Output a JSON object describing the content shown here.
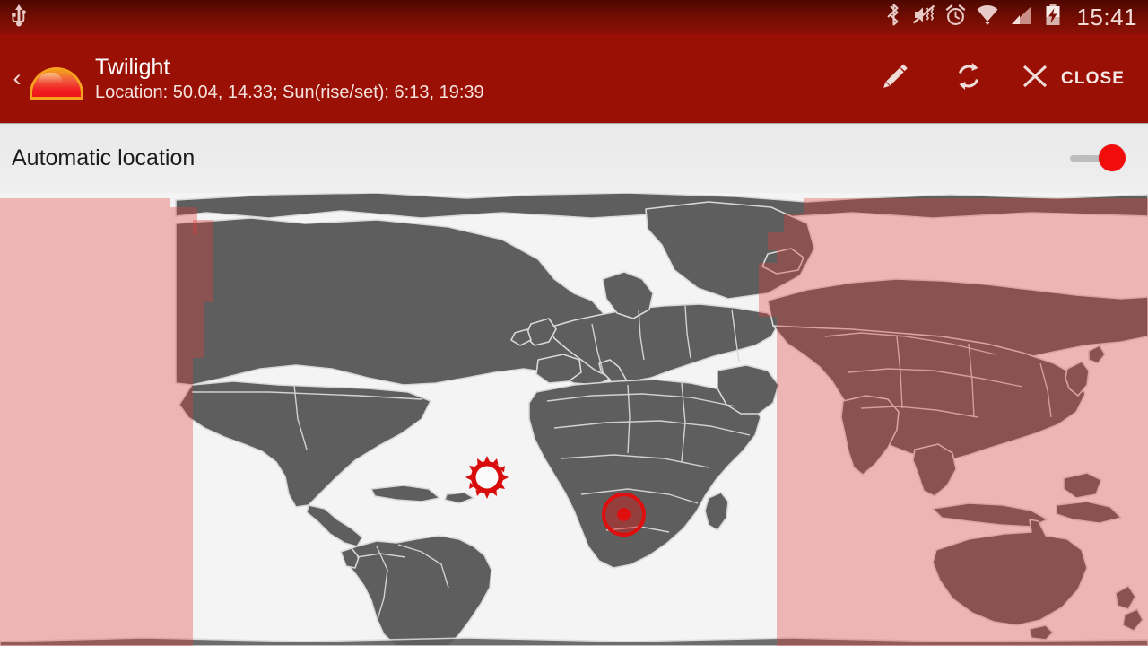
{
  "status_bar": {
    "time": "15:41",
    "icons": [
      {
        "name": "usb-icon",
        "label": "USB connected"
      },
      {
        "name": "bluetooth-icon",
        "label": "Bluetooth on"
      },
      {
        "name": "vibrate-muted-icon",
        "label": "Sound muted / vibrate"
      },
      {
        "name": "alarm-icon",
        "label": "Alarm set"
      },
      {
        "name": "wifi-icon",
        "label": "Wi-Fi connected"
      },
      {
        "name": "signal-bars-icon",
        "label": "Cellular signal"
      },
      {
        "name": "battery-charging-icon",
        "label": "Battery charging"
      }
    ]
  },
  "action_bar": {
    "back_chevron": "‹",
    "app_icon_name": "twilight-sunset-icon",
    "title": "Twilight",
    "subtitle": "Location: 50.04, 14.33; Sun(rise/set): 6:13, 19:39",
    "location_latitude": "50.04",
    "location_longitude": "14.33",
    "sunrise": "6:13",
    "sunset": "19:39",
    "edit_label": "Edit",
    "refresh_label": "Refresh",
    "close_label": "CLOSE"
  },
  "settings": {
    "automatic_location_label": "Automatic location",
    "automatic_location_enabled": true,
    "toggle_state": "on"
  },
  "map": {
    "location_marker_name": "current-location-marker",
    "sun_marker_name": "sun-position-marker",
    "projection": "equirectangular world map",
    "land_color": "#5e5e5e",
    "border_color": "#d8d8d8",
    "ocean_color": "#f4f4f4",
    "night_overlay_color": "#e23c3c",
    "night_overlay_opacity": "0.34"
  },
  "colors": {
    "accent": "#e00f0f",
    "action_bar": "#9a1005",
    "status_bar_top": "#4e0800",
    "status_bar_bottom": "#8d1106",
    "panel_background": "#ececec",
    "title_text": "#ffffff",
    "subtitle_text": "#f4e2df",
    "body_text": "#1c1c1c"
  }
}
